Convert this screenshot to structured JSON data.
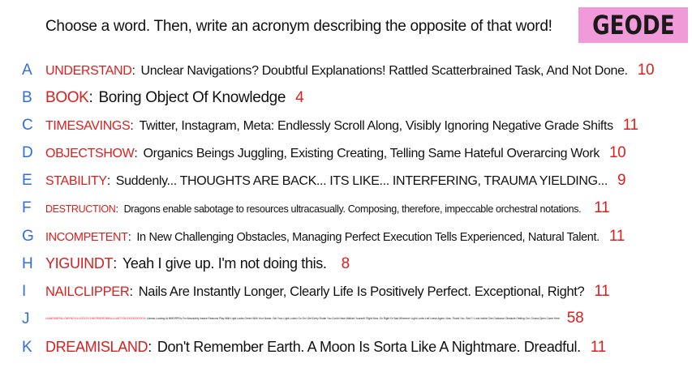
{
  "header": {
    "prompt": "Choose a word. Then, write an acronym describing the opposite of that word!",
    "badge": "GEODE"
  },
  "entries": [
    {
      "letter": "A",
      "word": "UNDERSTAND",
      "acronym": "Unclear Navigations? Doubtful Explanations! Rattled Scatterbrained Task, And Not Done.",
      "score": "10"
    },
    {
      "letter": "B",
      "word": "BOOK",
      "acronym": "Boring Object Of Knowledge",
      "score": "4"
    },
    {
      "letter": "C",
      "word": "TIMESAVINGS",
      "acronym": "Twitter, Instagram, Meta: Endlessly Scroll Along, Visibly Ignoring Negative Grade Shifts",
      "score": "11"
    },
    {
      "letter": "D",
      "word": "OBJECTSHOW",
      "acronym": "Organics Beings Juggling, Existing Creating, Telling Same Hateful Overarcing Work",
      "score": "10"
    },
    {
      "letter": "E",
      "word": "STABILITY",
      "acronym": "Suddenly... THOUGHTS ARE BACK... ITS LIKE... INTERFERING, TRAUMA YIELDING...",
      "score": "9"
    },
    {
      "letter": "F",
      "word": "DESTRUCTION",
      "acronym": "Dragons enable sabotage to resources ultracasually. Composing, therefore, impeccable orchestral notations.",
      "score": "11"
    },
    {
      "letter": "G",
      "word": "INCOMPETENT",
      "acronym": "In New Challenging Obstacles, Managing Perfect Execution Tells Experienced, Natural Talent.",
      "score": "11"
    },
    {
      "letter": "H",
      "word": "YIGUINDT",
      "acronym": "Yeah I give up. I'm not doing this.",
      "score": "8"
    },
    {
      "letter": "I",
      "word": "NAILCLIPPER",
      "acronym": "Nails Are Instantly Longer, Clearly Life Is Positively Perfect. Exceptional, Right?",
      "score": "11"
    },
    {
      "letter": "J",
      "word": "LLAMFAWPNLLOWYNGYLLGGGOYCHWYRNDROBWLLLLANTYSILIOGOGOGOCH",
      "acronym": "Llamas Looking At MMORPGs For Absolutely Insane Reasons Play With Light Looks Green With Your Name. Get Your Light Looks! Go On! Get Every Route You Could Have Walked Yourself. Right Now. Go Right Or Bad Wherever Light Looks Left Leave Again. Now, Thank You. See? I Look Inside One Guidance Obstacle Getting Out. Gonna Open Come Here.",
      "score": "58"
    },
    {
      "letter": "K",
      "word": "DREAMISLAND",
      "acronym": "Don't Remember Earth. A Moon Is Sorta Like A Nightmare. Dreadful.",
      "score": "11"
    }
  ],
  "colors": {
    "letter": "#2f6fd6",
    "word": "#d92020",
    "score": "#d92020",
    "badge_bg": "#f09ad9"
  }
}
